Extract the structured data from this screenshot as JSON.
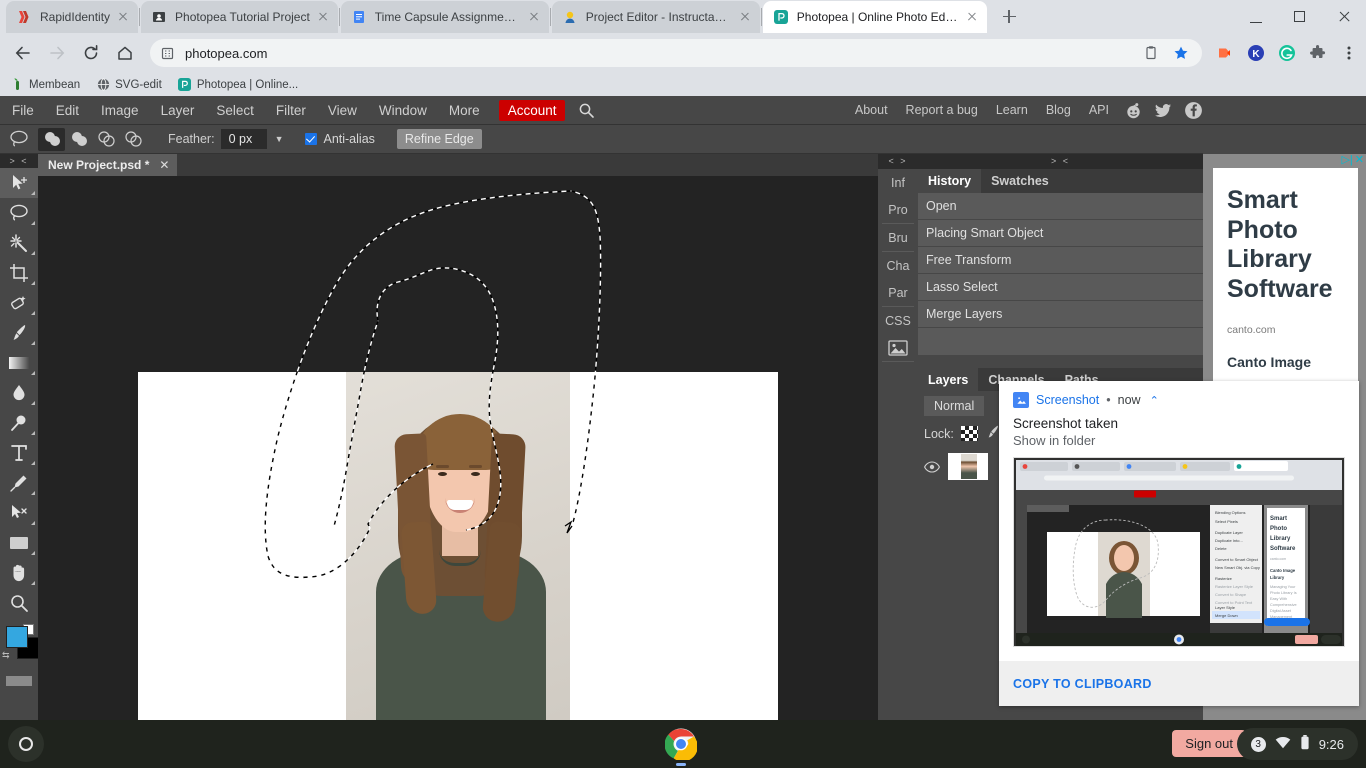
{
  "browser": {
    "tabs": [
      {
        "title": "RapidIdentity",
        "favicon": "rapididentity-icon",
        "active": false
      },
      {
        "title": "Photopea Tutorial Project",
        "favicon": "contact-card-icon",
        "active": false
      },
      {
        "title": "Time Capsule Assignment - Goo",
        "favicon": "google-docs-icon",
        "active": false
      },
      {
        "title": "Project Editor - Instructables",
        "favicon": "instructables-icon",
        "active": false
      },
      {
        "title": "Photopea | Online Photo Editor",
        "favicon": "photopea-icon",
        "active": true
      }
    ],
    "new_tab_label": "+",
    "window_controls": {
      "minimize": "minimize-icon",
      "maximize": "restore-icon",
      "close": "close-icon"
    },
    "nav": {
      "back": "back-arrow-icon",
      "forward": "forward-arrow-icon",
      "reload": "reload-icon",
      "home": "home-icon"
    },
    "address": {
      "value": "photopea.com",
      "site_icon": "site-info-icon"
    },
    "omni_actions": [
      "clipboard-icon",
      "bookmark-star-icon"
    ],
    "extensions": [
      "honey-icon",
      "kami-icon",
      "grammarly-icon",
      "puzzle-icon",
      "three-dot-menu-icon"
    ],
    "bookmarks": [
      {
        "label": "Membean",
        "icon": "membean-icon"
      },
      {
        "label": "SVG-edit",
        "icon": "globe-icon"
      },
      {
        "label": "Photopea | Online...",
        "icon": "photopea-icon"
      }
    ]
  },
  "photopea": {
    "menus": [
      "File",
      "Edit",
      "Image",
      "Layer",
      "Select",
      "Filter",
      "View",
      "Window",
      "More"
    ],
    "account_label": "Account",
    "search_icon": "search-icon",
    "right_links": [
      "About",
      "Report a bug",
      "Learn",
      "Blog",
      "API"
    ],
    "social": [
      "reddit-icon",
      "twitter-icon",
      "facebook-icon"
    ],
    "options_bar": {
      "tool_icon": "lasso-tool-icon",
      "bool_modes": [
        "new-selection-icon",
        "add-to-selection-icon",
        "subtract-from-selection-icon",
        "intersect-selection-icon"
      ],
      "selected_bool_index": 0,
      "feather_label": "Feather:",
      "feather_value": "0 px",
      "dropdown_icon": "chevron-down-icon",
      "antialias_label": "Anti-alias",
      "antialias_checked": true,
      "refine_edge_label": "Refine Edge"
    },
    "tools": [
      "move-tool-icon",
      "lasso-tool-icon",
      "magic-wand-tool-icon",
      "crop-tool-icon",
      "patch-tool-icon",
      "brush-tool-icon",
      "gradient-tool-icon",
      "blur-tool-icon",
      "dodge-tool-icon",
      "type-tool-icon",
      "pen-tool-icon",
      "path-select-tool-icon",
      "shape-tool-icon",
      "hand-tool-icon",
      "zoom-tool-icon"
    ],
    "selected_tool_index": 1,
    "colors": {
      "foreground": "#34a7e0",
      "background": "#000000",
      "accent": "#cc0000"
    },
    "document_tab": {
      "name": "New Project.psd *",
      "close_icon": "close-icon"
    },
    "panel_rail": [
      "Inf",
      "Pro",
      "Bru",
      "Cha",
      "Par",
      "CSS",
      "image-panel-icon"
    ],
    "grip_label": "> <",
    "rail_grip_label": "< >",
    "history_panel": {
      "tabs": [
        "History",
        "Swatches"
      ],
      "active_tab": "History",
      "items": [
        "Open",
        "Placing Smart Object",
        "Free Transform",
        "Lasso Select",
        "Merge Layers"
      ]
    },
    "layers_panel": {
      "tabs": [
        "Layers",
        "Channels",
        "Paths"
      ],
      "active_tab": "Layers",
      "blend_mode": "Normal",
      "lock_label": "Lock:",
      "lock_icons": [
        "transparent-pixels-icon",
        "paint-pixels-icon"
      ],
      "layer": {
        "visible_icon": "eye-icon",
        "thumbnail": "layer-thumbnail"
      }
    }
  },
  "ad": {
    "headline": "Smart Photo Library Software",
    "url": "canto.com",
    "subhead": "Canto Image",
    "adchoices_icon": "adchoices-icon",
    "close_icon": "close-icon"
  },
  "notification": {
    "app_icon": "screenshot-app-icon",
    "app_name": "Screenshot",
    "separator": "•",
    "time": "now",
    "collapse_icon": "chevron-up-icon",
    "title": "Screenshot taken",
    "link": "Show in folder",
    "action": "COPY TO CLIPBOARD",
    "thumbnail": "screenshot-preview"
  },
  "shelf": {
    "launcher_icon": "launcher-icon",
    "chrome_icon": "chrome-icon",
    "sign_out_label": "Sign out",
    "tray": {
      "notification_count": "3",
      "wifi_icon": "wifi-icon",
      "battery_icon": "battery-icon",
      "time": "9:26"
    }
  }
}
